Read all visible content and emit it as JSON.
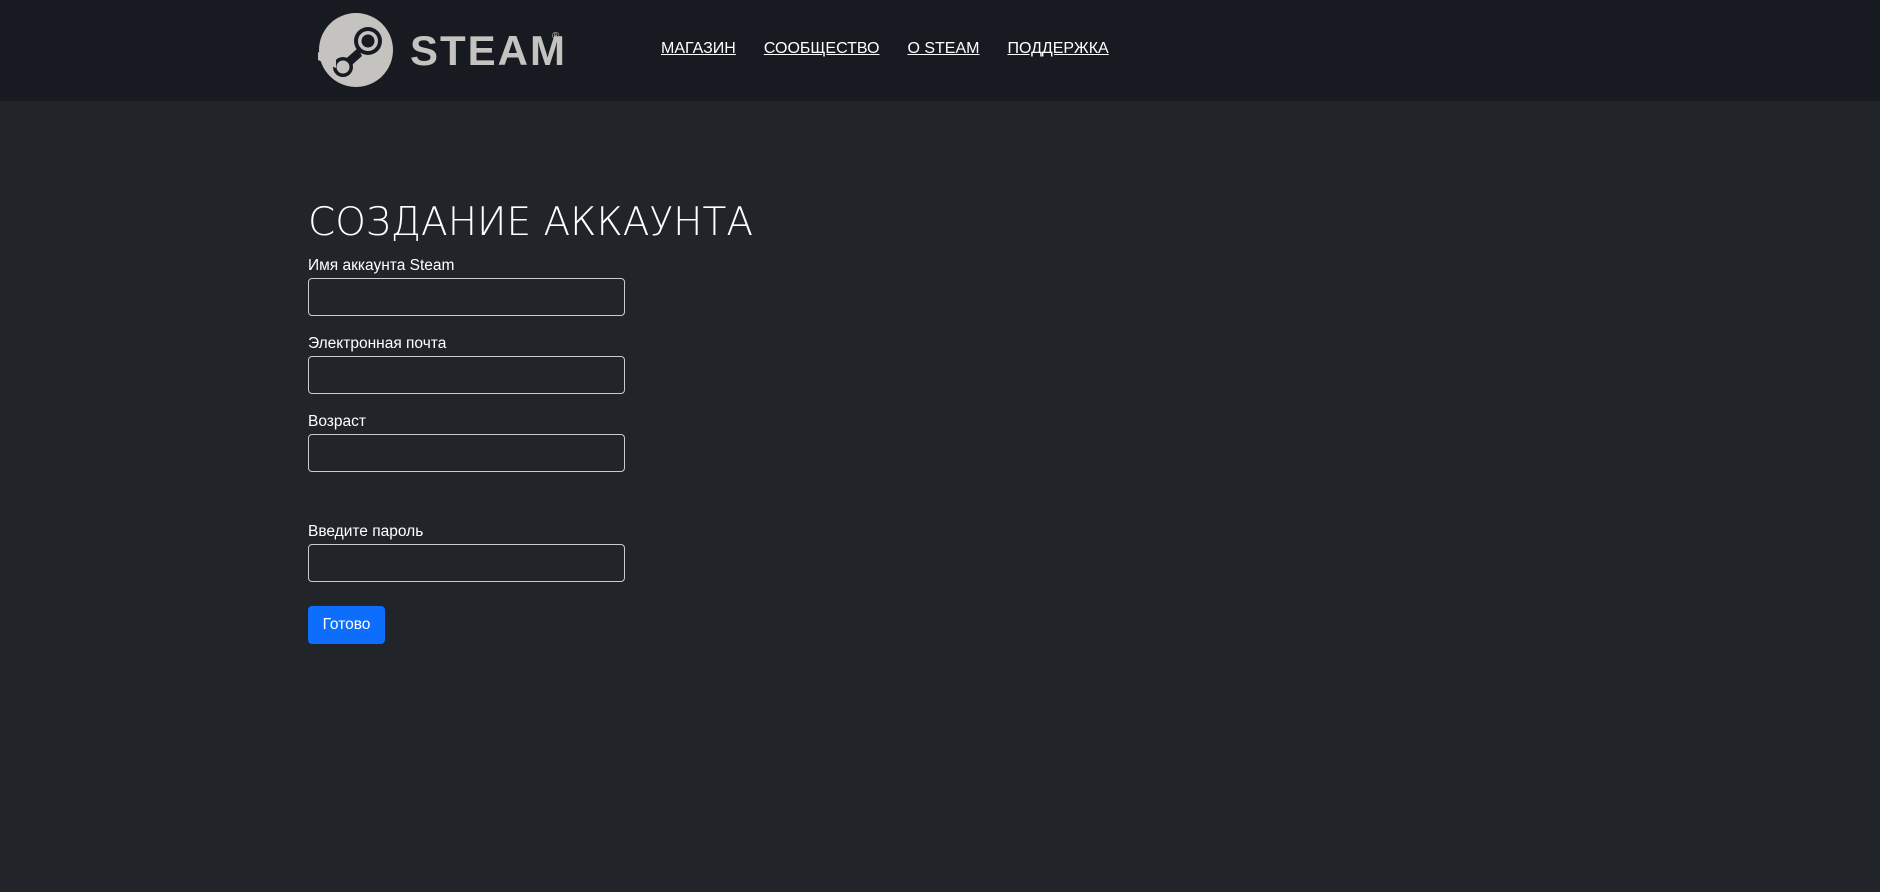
{
  "brand": {
    "logo_text": "STEAM",
    "registered_mark": "®",
    "logo_icon": "steam-logo-icon"
  },
  "nav": {
    "items": [
      {
        "label": "МАГАЗИН"
      },
      {
        "label": "СООБЩЕСТВО"
      },
      {
        "label": "О STEAM"
      },
      {
        "label": "ПОДДЕРЖКА"
      }
    ]
  },
  "form": {
    "title": "СОЗДАНИЕ АККАУНТА",
    "account_name_label": "Имя аккаунта Steam",
    "account_name_value": "",
    "email_label": "Электронная почта",
    "email_value": "",
    "age_label": "Возраст",
    "age_value": "",
    "password_label": "Введите пароль",
    "password_value": "",
    "submit_label": "Готово"
  },
  "colors": {
    "header_bg": "#171a21",
    "page_bg": "#212429",
    "accent": "#0d6efd"
  }
}
